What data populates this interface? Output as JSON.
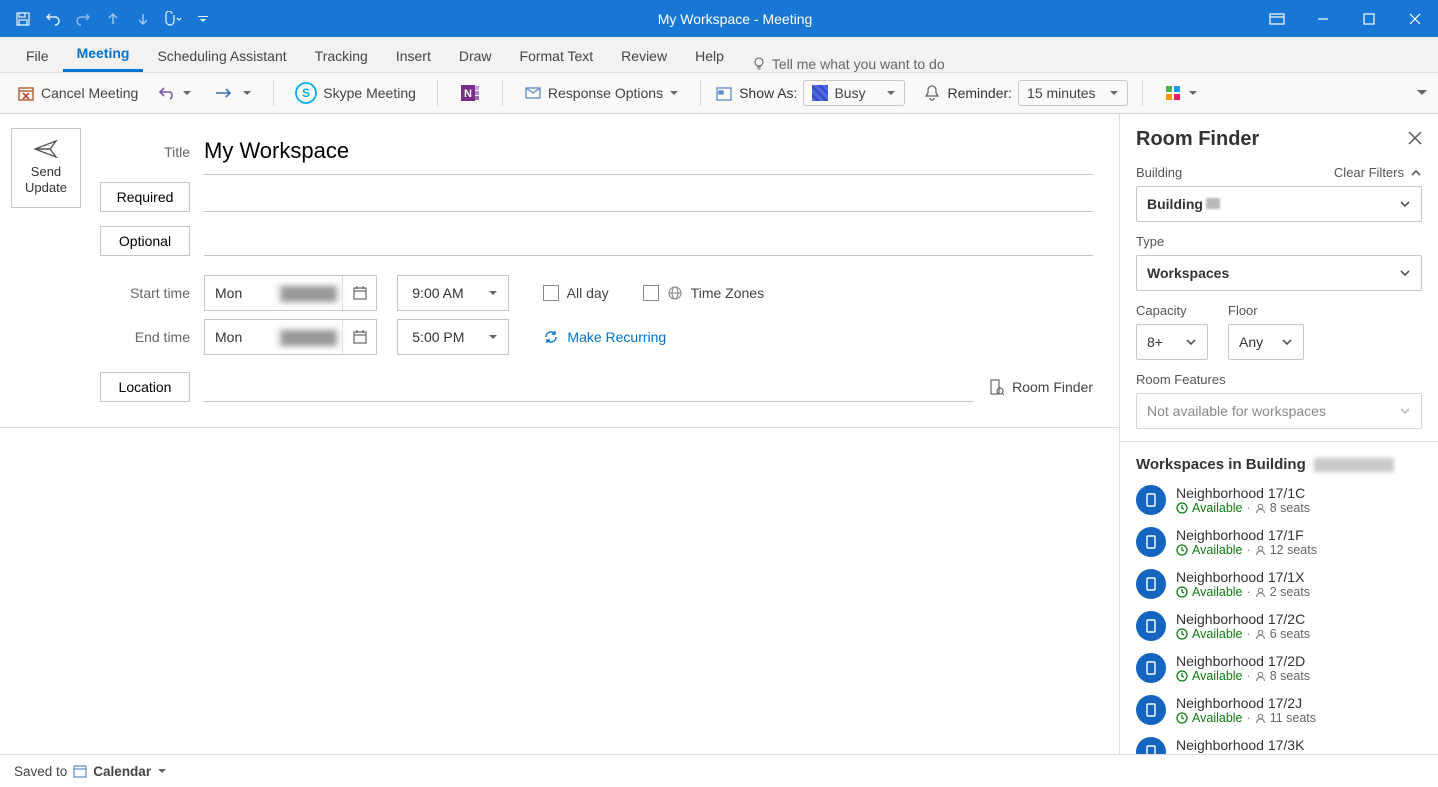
{
  "window": {
    "title": "My Workspace - Meeting"
  },
  "ribbon": {
    "tabs": [
      "File",
      "Meeting",
      "Scheduling Assistant",
      "Tracking",
      "Insert",
      "Draw",
      "Format Text",
      "Review",
      "Help"
    ],
    "active_tab_index": 1,
    "tell_me": "Tell me what you want to do",
    "cancel_meeting": "Cancel Meeting",
    "skype_meeting": "Skype Meeting",
    "response_options": "Response Options",
    "show_as_label": "Show As:",
    "show_as_value": "Busy",
    "reminder_label": "Reminder:",
    "reminder_value": "15 minutes"
  },
  "form": {
    "send_update": "Send Update",
    "title_label": "Title",
    "title_value": "My Workspace",
    "required_label": "Required",
    "optional_label": "Optional",
    "start_time_label": "Start time",
    "end_time_label": "End time",
    "start_date_day": "Mon",
    "end_date_day": "Mon",
    "start_time": "9:00 AM",
    "end_time": "5:00 PM",
    "all_day": "All day",
    "time_zones": "Time Zones",
    "make_recurring": "Make Recurring",
    "location_label": "Location",
    "room_finder_link": "Room Finder"
  },
  "room_finder": {
    "title": "Room Finder",
    "building_label": "Building",
    "clear_filters": "Clear Filters",
    "building_value": "Building",
    "type_label": "Type",
    "type_value": "Workspaces",
    "capacity_label": "Capacity",
    "capacity_value": "8+",
    "floor_label": "Floor",
    "floor_value": "Any",
    "features_label": "Room Features",
    "features_value": "Not available for workspaces",
    "list_heading_prefix": "Workspaces in Building",
    "workspaces": [
      {
        "name": "Neighborhood 17/1C",
        "status": "Available",
        "seats": "8 seats"
      },
      {
        "name": "Neighborhood 17/1F",
        "status": "Available",
        "seats": "12 seats"
      },
      {
        "name": "Neighborhood 17/1X",
        "status": "Available",
        "seats": "2 seats"
      },
      {
        "name": "Neighborhood 17/2C",
        "status": "Available",
        "seats": "6 seats"
      },
      {
        "name": "Neighborhood 17/2D",
        "status": "Available",
        "seats": "8 seats"
      },
      {
        "name": "Neighborhood 17/2J",
        "status": "Available",
        "seats": "11 seats"
      },
      {
        "name": "Neighborhood 17/3K",
        "status": "",
        "seats": ""
      }
    ]
  },
  "status": {
    "saved_to": "Saved to",
    "calendar": "Calendar"
  }
}
